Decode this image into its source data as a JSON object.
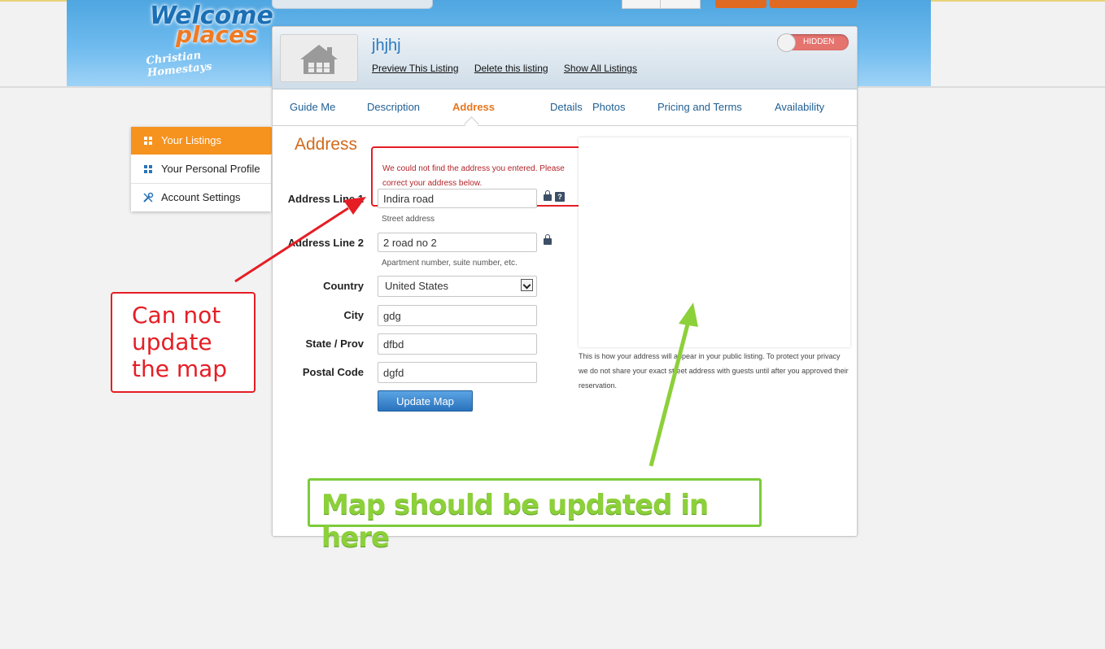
{
  "logo": {
    "line1": "Welcome",
    "line2": "places",
    "tagline": "Christian Homestays"
  },
  "listing": {
    "title": "jhjhj",
    "links": {
      "preview": "Preview This Listing",
      "delete": "Delete this listing",
      "show_all": "Show All Listings"
    },
    "visibility_toggle": "HIDDEN"
  },
  "tabs": [
    "Guide Me",
    "Description",
    "Address",
    "Details",
    "Photos",
    "Pricing and Terms",
    "Availability"
  ],
  "active_tab": "Address",
  "sidebar": {
    "items": [
      {
        "label": "Your Listings",
        "active": true
      },
      {
        "label": "Your Personal Profile",
        "active": false
      },
      {
        "label": "Account Settings",
        "active": false
      }
    ]
  },
  "form": {
    "section_title": "Address",
    "error": "We could not find the address you entered. Please correct your address below.",
    "address1": {
      "label": "Address Line 1",
      "value": "Indira road",
      "hint": "Street address"
    },
    "address2": {
      "label": "Address Line 2",
      "value": "2 road no 2",
      "hint": "Apartment number, suite number, etc."
    },
    "country": {
      "label": "Country",
      "value": "United States"
    },
    "city": {
      "label": "City",
      "value": "gdg"
    },
    "state": {
      "label": "State / Prov",
      "value": "dfbd"
    },
    "postal": {
      "label": "Postal Code",
      "value": "dgfd"
    },
    "submit": "Update Map",
    "help_mark": "?"
  },
  "map": {
    "note": "This is how your address will appear in your public listing. To protect your privacy we do not share your exact street address with guests until after you approved their reservation."
  },
  "annotations": {
    "red": "Can not update the map",
    "green": "Map should be updated in here"
  },
  "colors": {
    "accent_orange": "#f6921e",
    "link_blue": "#1f5f93",
    "error_red": "#e51e25",
    "annotation_green": "#8cd03a"
  }
}
